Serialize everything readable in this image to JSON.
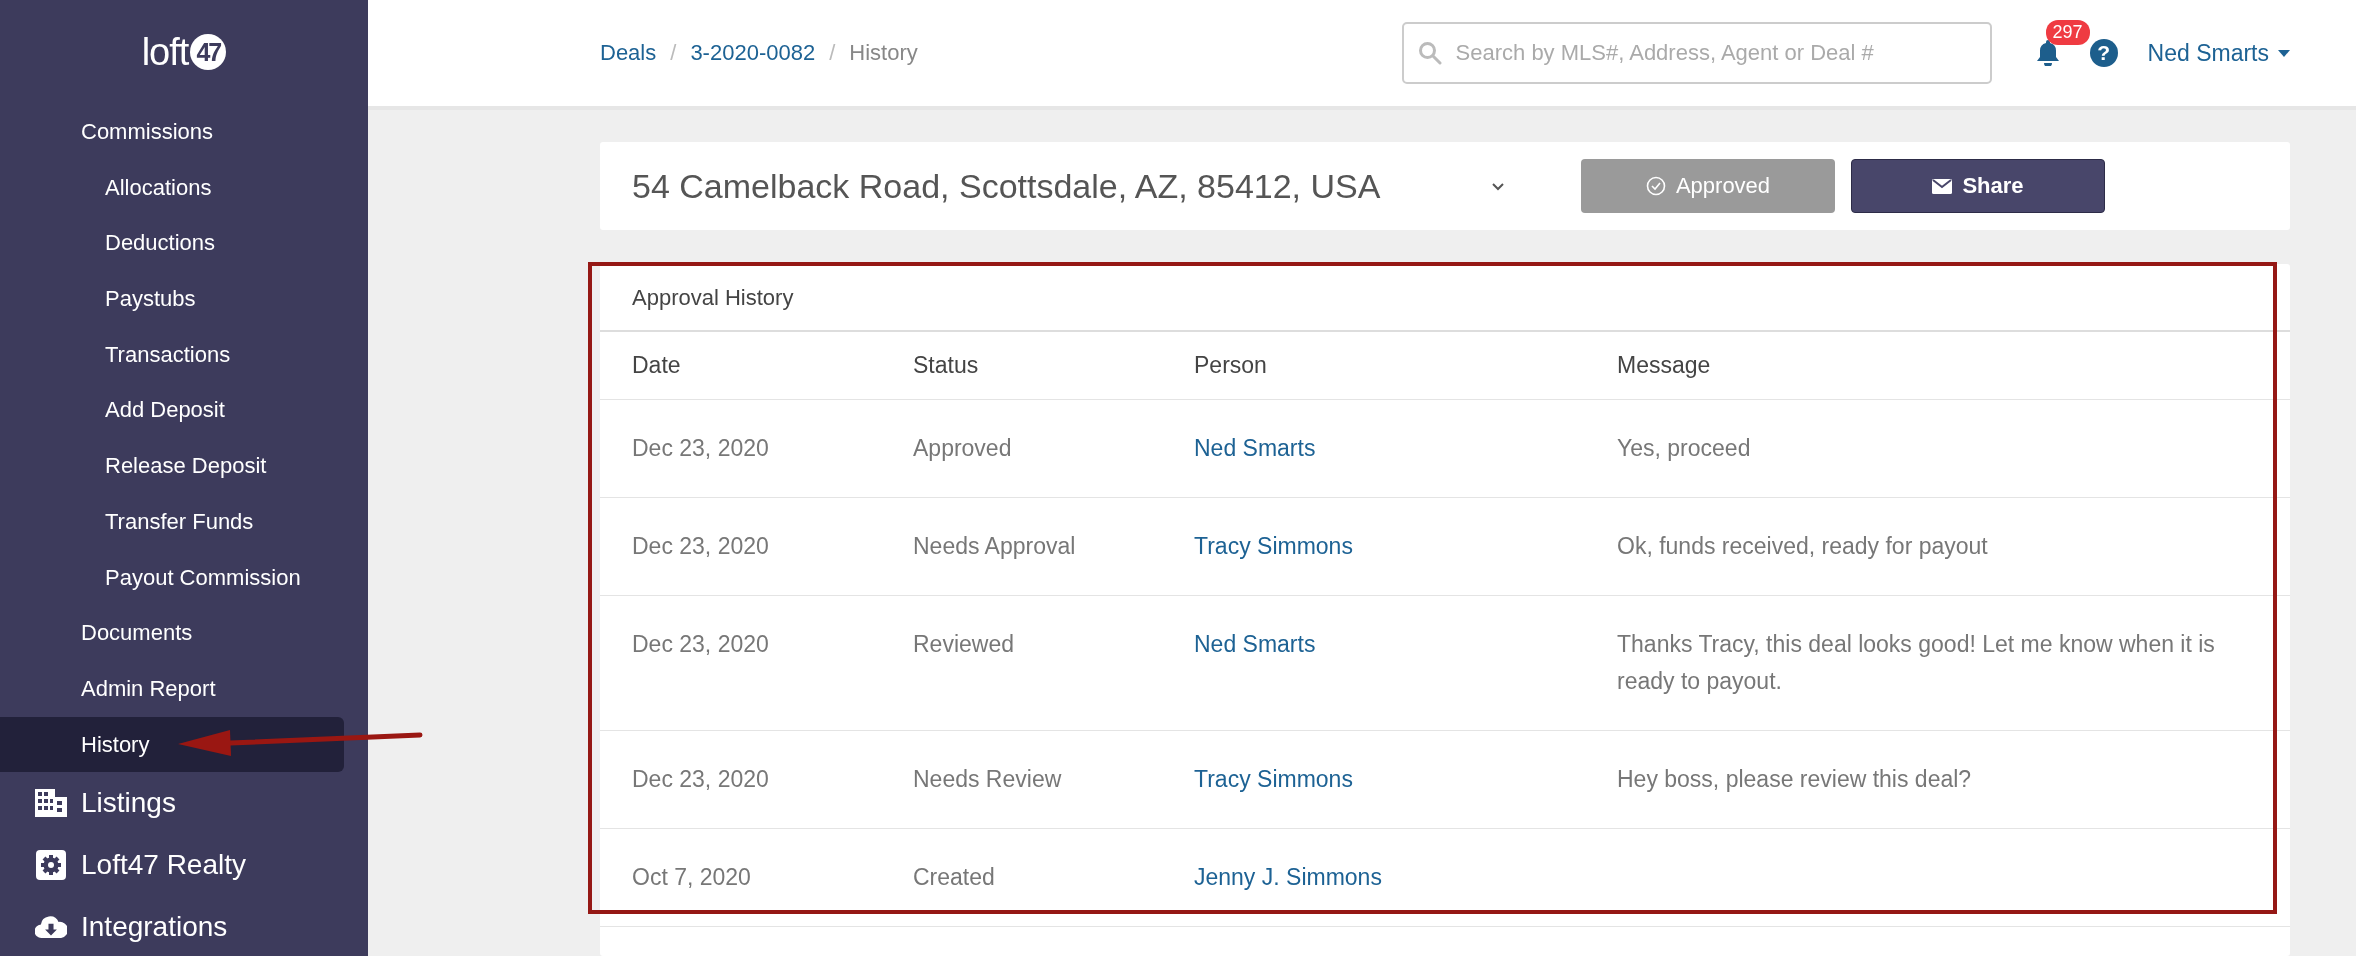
{
  "sidebar": {
    "logo": {
      "text": "loft",
      "mark": "47"
    },
    "items": [
      {
        "label": "Commissions",
        "kind": "link",
        "selected": false,
        "children": [
          {
            "label": "Allocations",
            "selected": false
          },
          {
            "label": "Deductions",
            "selected": false
          },
          {
            "label": "Paystubs",
            "selected": false
          },
          {
            "label": "Transactions",
            "selected": false
          },
          {
            "label": "Add Deposit",
            "selected": false
          },
          {
            "label": "Release Deposit",
            "selected": false
          },
          {
            "label": "Transfer Funds",
            "selected": false
          },
          {
            "label": "Payout Commission",
            "selected": false
          }
        ]
      },
      {
        "label": "Documents",
        "kind": "link",
        "selected": false
      },
      {
        "label": "Admin Report",
        "kind": "link",
        "selected": false
      },
      {
        "label": "History",
        "kind": "link",
        "selected": true
      },
      {
        "label": "Listings",
        "kind": "section",
        "selected": false
      },
      {
        "label": "Loft47 Realty",
        "kind": "section",
        "selected": false
      },
      {
        "label": "Integrations",
        "kind": "section",
        "selected": false
      }
    ]
  },
  "header": {
    "breadcrumbs": [
      {
        "label": "Deals",
        "kind": "link"
      },
      {
        "label": "/",
        "kind": "separator"
      },
      {
        "label": "3-2020-0082",
        "kind": "link"
      },
      {
        "label": "/",
        "kind": "separator"
      },
      {
        "label": "History",
        "kind": "current"
      }
    ],
    "search": {
      "placeholder": "Search by MLS#, Address, Agent or Deal #"
    },
    "notifications": {
      "count": "297"
    },
    "help": "?",
    "user": "Ned Smarts"
  },
  "deal": {
    "address": "54 Camelback Road, Scottsdale, AZ, 85412, USA",
    "buttons": [
      {
        "label": "Approved",
        "kind": "approve",
        "disabled": true
      },
      {
        "label": "Share",
        "kind": "share"
      }
    ]
  },
  "history": {
    "title": "Approval History",
    "columns": [
      "Date",
      "Status",
      "Person",
      "Message"
    ],
    "rows": [
      {
        "date": "Dec 23, 2020",
        "status": "Approved",
        "person": "Ned Smarts",
        "message": "Yes, proceed"
      },
      {
        "date": "Dec 23, 2020",
        "status": "Needs Approval",
        "person": "Tracy Simmons",
        "message": "Ok, funds received, ready for payout"
      },
      {
        "date": "Dec 23, 2020",
        "status": "Reviewed",
        "person": "Ned Smarts",
        "message": "Thanks Tracy, this deal looks good! Let me know when it is ready to payout."
      },
      {
        "date": "Dec 23, 2020",
        "status": "Needs Review",
        "person": "Tracy Simmons",
        "message": "Hey boss, please review this deal?"
      },
      {
        "date": "Oct 7, 2020",
        "status": "Created",
        "person": "Jenny J. Simmons"
      }
    ]
  }
}
